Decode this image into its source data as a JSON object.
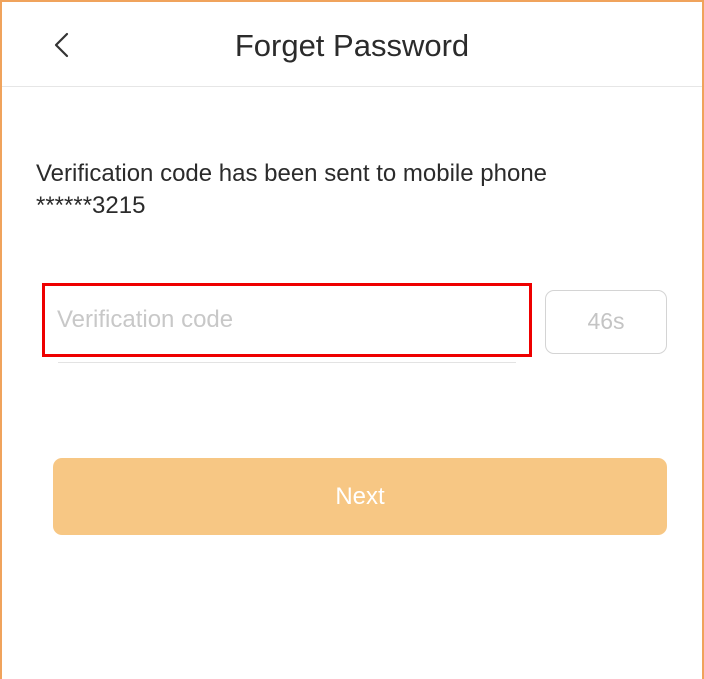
{
  "header": {
    "title": "Forget Password"
  },
  "message": {
    "line1": "Verification code has been sent to mobile phone",
    "line2": "******3215"
  },
  "form": {
    "code_placeholder": "Verification code",
    "code_value": "",
    "countdown_label": "46s",
    "next_label": "Next"
  },
  "colors": {
    "accent_border": "#f0a35c",
    "highlight_box": "#ee0000",
    "next_button_bg": "#f7c784",
    "placeholder": "#c8c8c8"
  },
  "icons": {
    "back": "chevron-left-icon"
  }
}
